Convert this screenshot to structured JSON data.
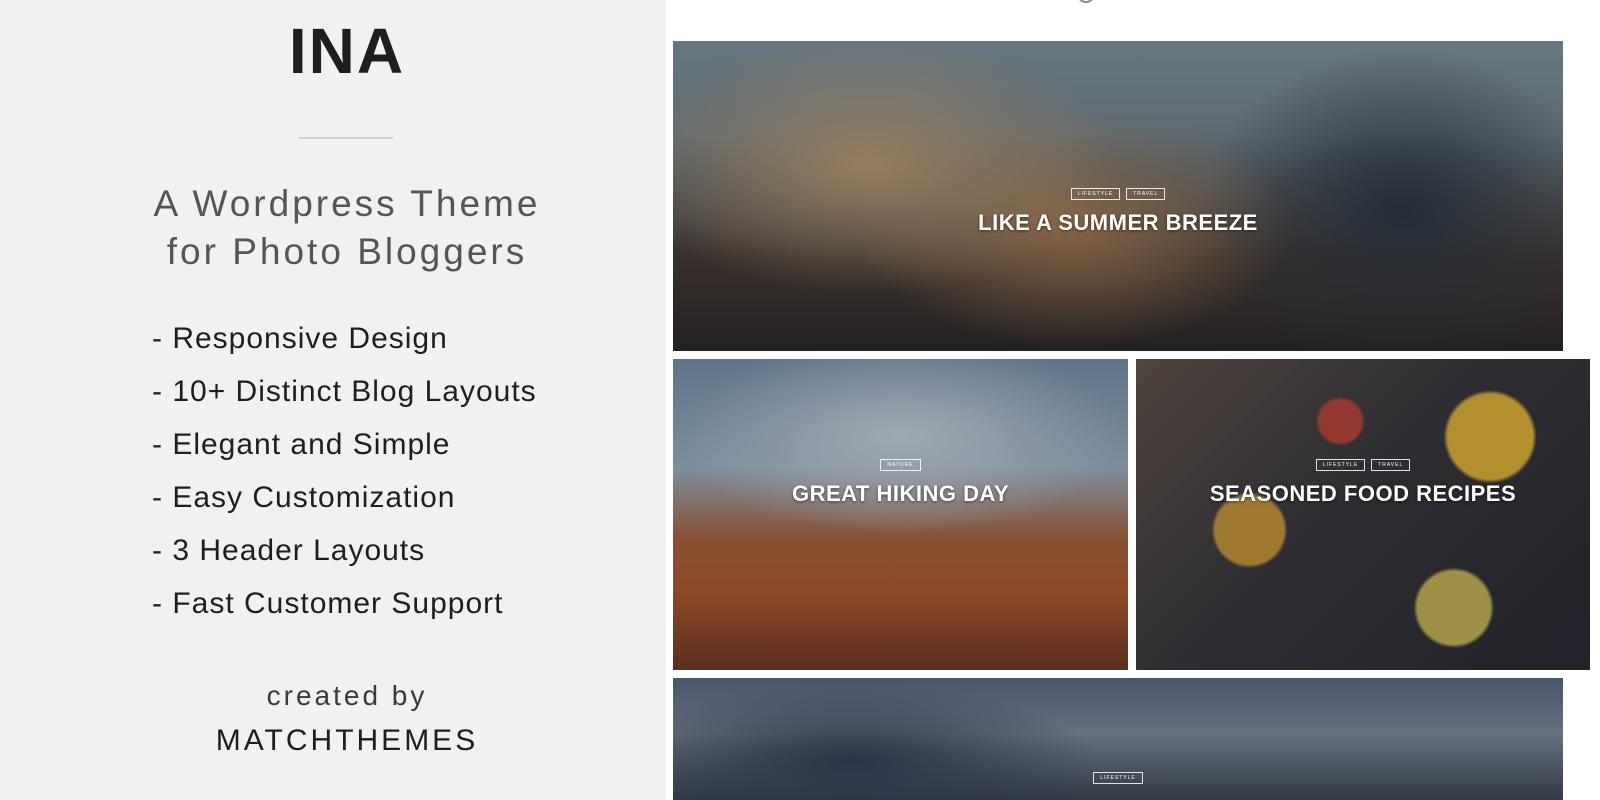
{
  "promo": {
    "logo": "INA",
    "tagline_line1": "A Wordpress Theme",
    "tagline_line2": "for Photo Bloggers",
    "features": [
      "- Responsive Design",
      "- 10+ Distinct Blog Layouts",
      "- Elegant and Simple",
      "- Easy Customization",
      "- 3 Header Layouts",
      "- Fast Customer Support"
    ],
    "credit_label": "created by",
    "credit_name": "MATCHTHEMES"
  },
  "preview": {
    "posts": [
      {
        "tags": [
          "LIFESTYLE",
          "TRAVEL"
        ],
        "title": "LIKE A SUMMER BREEZE",
        "image": "woman-hair-wind-photo"
      },
      {
        "tags": [
          "NATURE"
        ],
        "title": "GREAT HIKING DAY",
        "image": "canyon-hiker-photo"
      },
      {
        "tags": [
          "LIFESTYLE",
          "TRAVEL"
        ],
        "title": "SEASONED FOOD RECIPES",
        "image": "food-table-photo"
      },
      {
        "tags": [
          "LIFESTYLE"
        ],
        "title": "",
        "image": "reading-book-photo"
      }
    ]
  },
  "colors": {
    "panel_bg": "#f1f1f1",
    "text_dark": "#1e1e1e",
    "text_muted": "#555555"
  }
}
